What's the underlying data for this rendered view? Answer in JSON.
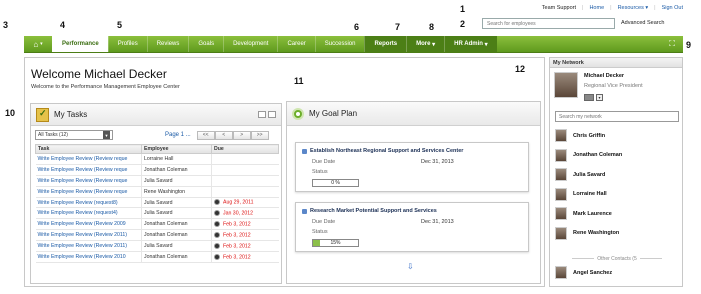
{
  "callouts": [
    "1",
    "2",
    "3",
    "4",
    "5",
    "6",
    "7",
    "8",
    "9",
    "10",
    "11",
    "12"
  ],
  "top_links": {
    "team": "Team Support",
    "home": "Home",
    "resources": "Resources",
    "signout": "Sign Out"
  },
  "search": {
    "placeholder": "Search for employees",
    "advanced": "Advanced Search"
  },
  "nav": {
    "items": [
      "Performance",
      "Profiles",
      "Reviews",
      "Goals",
      "Development",
      "Career",
      "Succession"
    ],
    "reports": "Reports",
    "more": "More",
    "hr_admin": "HR Admin"
  },
  "welcome": {
    "title": "Welcome Michael Decker",
    "subtitle": "Welcome to the Performance Management Employee Center"
  },
  "tasks": {
    "title": "My Tasks",
    "filter": "All Tasks (12)",
    "page_label": "Page 1 ...",
    "pager": [
      "<<",
      "<",
      ">",
      ">>"
    ],
    "columns": [
      "Task",
      "Employee",
      "Due"
    ],
    "rows": [
      {
        "task": "Write Employee Review (Review reque",
        "employee": "Lorraine Hall",
        "due": ""
      },
      {
        "task": "Write Employee Review (Review reque",
        "employee": "Jonathan Coleman",
        "due": ""
      },
      {
        "task": "Write Employee Review (Review reque",
        "employee": "Julia Savard",
        "due": ""
      },
      {
        "task": "Write Employee Review (Review reque",
        "employee": "Rene Washington",
        "due": ""
      },
      {
        "task": "Write Employee Review (request8)",
        "employee": "Julia Savard",
        "due": "Aug 29, 2011"
      },
      {
        "task": "Write Employee Review (request4)",
        "employee": "Julia Savard",
        "due": "Jan 30, 2012"
      },
      {
        "task": "Write Employee Review (Review 2009",
        "employee": "Jonathan Coleman",
        "due": "Feb 3, 2012"
      },
      {
        "task": "Write Employee Review (Review 2011)",
        "employee": "Jonathan Coleman",
        "due": "Feb 3, 2012"
      },
      {
        "task": "Write Employee Review (Review 2011)",
        "employee": "Julia Savard",
        "due": "Feb 3, 2012"
      },
      {
        "task": "Write Employee Review (Review 2010",
        "employee": "Jonathan Coleman",
        "due": "Feb 3, 2012"
      }
    ]
  },
  "goals": {
    "title": "My Goal Plan",
    "due_label": "Due Date",
    "status_label": "Status",
    "cards": [
      {
        "title": "Establish Northeast Regional Support and Services Center",
        "due": "Dec 31, 2013",
        "progress": 0,
        "progress_label": "0 %"
      },
      {
        "title": "Research Market Potential Support and Services",
        "due": "Dec 31, 2013",
        "progress": 15,
        "progress_label": "15%"
      }
    ]
  },
  "network": {
    "title": "My Network",
    "me": {
      "name": "Michael Decker",
      "title": "Regional Vice President"
    },
    "search_placeholder": "Search my network",
    "contacts": [
      "Chris Griffin",
      "Jonathan Coleman",
      "Julia Savard",
      "Lorraine Hall",
      "Mark Laurence",
      "Rene Washington"
    ],
    "other_label": "Other Contacts (5",
    "other_contacts": [
      "Angel Sanchez"
    ]
  }
}
